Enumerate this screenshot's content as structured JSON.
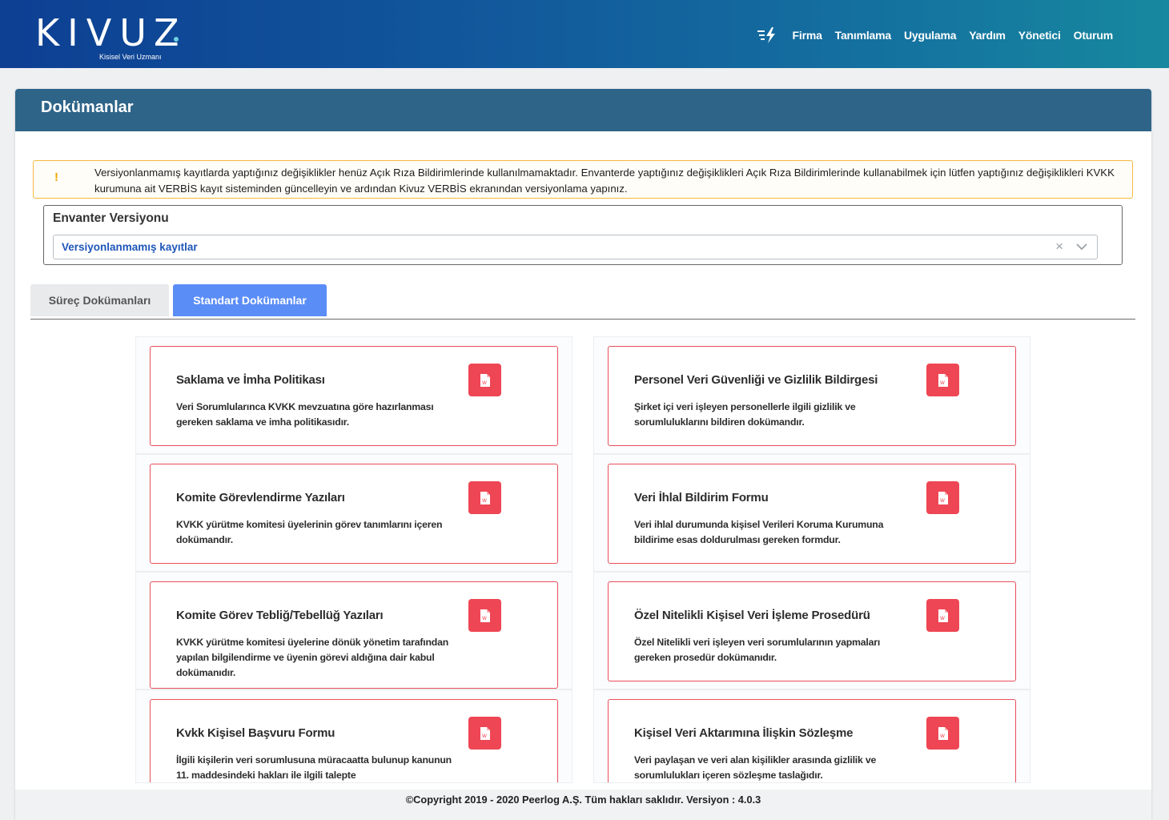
{
  "brand": {
    "logo_text": "KIVUZ",
    "tagline": "Kisisel Veri Uzmanı"
  },
  "nav": {
    "items": [
      "Firma",
      "Tanımlama",
      "Uygulama",
      "Yardım",
      "Yönetici",
      "Oturum"
    ]
  },
  "panel": {
    "title": "Dokümanlar"
  },
  "alert": {
    "icon": "!",
    "text": "Versiyonlanmamış kayıtlarda yaptığınız değişiklikler henüz Açık Rıza Bildirimlerinde kullanılmamaktadır. Envanterde yaptığınız değişiklikleri Açık Rıza Bildirimlerinde kullanabilmek için lütfen yaptığınız değişiklikleri KVKK kurumuna ait VERBİS kayıt sisteminden güncelleyin ve ardından Kivuz VERBİS ekranından versiyonlama yapınız."
  },
  "inventory": {
    "label": "Envanter Versiyonu",
    "selected": "Versiyonlanmamış kayıtlar",
    "clear_symbol": "×"
  },
  "tabs": [
    {
      "label": "Süreç Dokümanları",
      "active": false
    },
    {
      "label": "Standart Dokümanlar",
      "active": true
    }
  ],
  "documents_left": [
    {
      "title": "Saklama ve İmha Politikası",
      "desc": "Veri Sorumlularınca KVKK mevzuatına göre hazırlanması gereken saklama ve imha politikasıdır."
    },
    {
      "title": "Komite Görevlendirme Yazıları",
      "desc": "KVKK yürütme komitesi üyelerinin görev tanımlarını içeren dokümandır."
    },
    {
      "title": "Komite Görev Tebliğ/Tebellüğ Yazıları",
      "desc": "KVKK yürütme komitesi üyelerine dönük yönetim tarafından yapılan bilgilendirme ve üyenin görevi aldığına dair kabul dokümanıdır."
    },
    {
      "title": "Kvkk Kişisel Başvuru Formu",
      "desc": "İlgili kişilerin veri sorumlusuna müracaatta bulunup kanunun 11. maddesindeki hakları ile ilgili talepte"
    }
  ],
  "documents_right": [
    {
      "title": "Personel Veri Güvenliği ve Gizlilik Bildirgesi",
      "desc": "Şirket içi veri işleyen personellerle ilgili gizlilik ve sorumluluklarını bildiren dokümandır."
    },
    {
      "title": "Veri İhlal Bildirim Formu",
      "desc": "Veri ihlal durumunda kişisel Verileri Koruma Kurumuna bildirime esas doldurulması gereken formdur."
    },
    {
      "title": "Özel Nitelikli Kişisel Veri İşleme Prosedürü",
      "desc": "Özel Nitelikli veri işleyen veri sorumlularının yapmaları gereken prosedür dokümanıdır."
    },
    {
      "title": "Kişisel Veri Aktarımına İlişkin Sözleşme",
      "desc": "Veri paylaşan ve veri alan kişilikler arasında gizlilik ve sorumlulukları içeren sözleşme taslağıdır."
    }
  ],
  "footer": {
    "text": "©Copyright 2019 - 2020 Peerlog A.Ş. Tüm hakları saklıdır. Versiyon : 4.0.3"
  },
  "colors": {
    "header_start": "#0d3f93",
    "header_end": "#17889f",
    "panel_head": "#2f6489",
    "accent": "#5b8df7",
    "card_border": "#e8505b",
    "doc_button": "#ee4654",
    "alert_border": "#f5b942"
  }
}
